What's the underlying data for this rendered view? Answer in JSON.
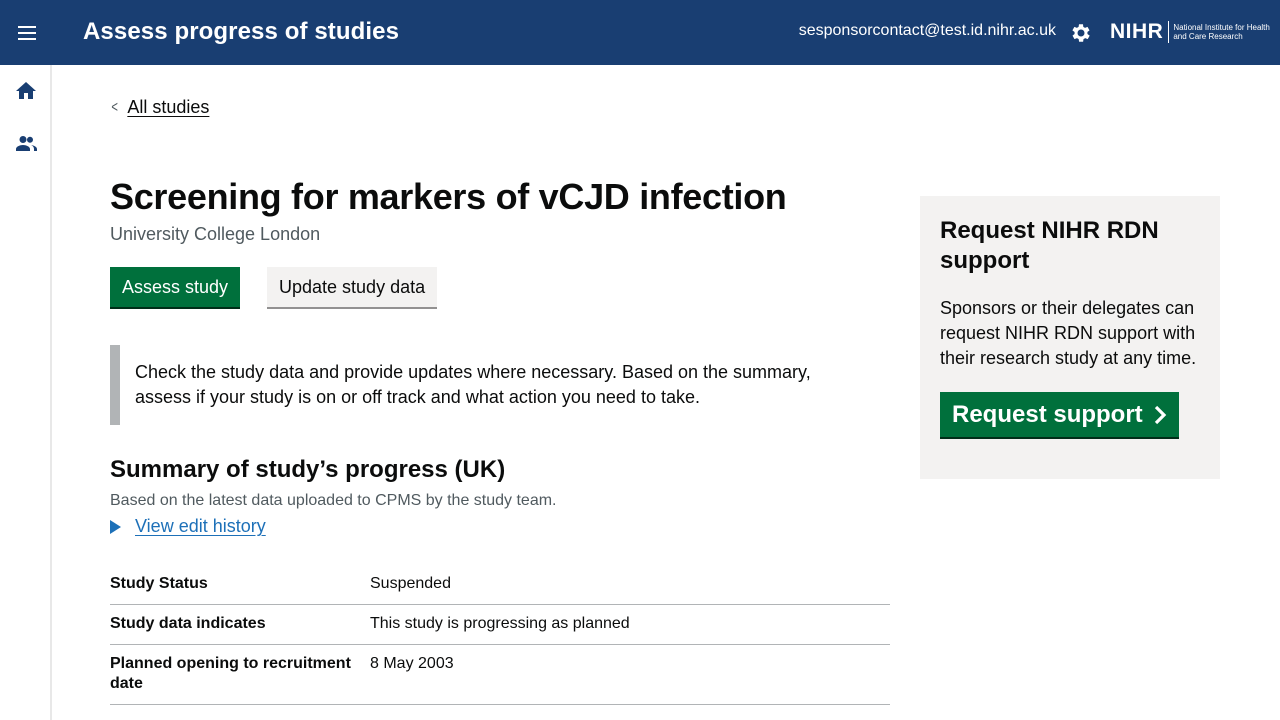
{
  "header": {
    "app_title": "Assess progress of studies",
    "user_email": "sesponsorcontact@test.id.nihr.ac.uk",
    "logo_mark": "NIHR",
    "logo_text": "National Institute for Health and Care Research",
    "menu_icon": "hamburger-menu-icon",
    "settings_icon": "gear-icon",
    "bg_color": "#193e72"
  },
  "sidebar": {
    "items": [
      {
        "icon": "home-icon"
      },
      {
        "icon": "users-icon"
      }
    ]
  },
  "breadcrumb": {
    "back_label": "All studies"
  },
  "study": {
    "title": "Screening for markers of vCJD infection",
    "organisation": "University College London"
  },
  "actions": {
    "assess_label": "Assess study",
    "update_label": "Update study data",
    "primary_color": "#00703c"
  },
  "inset_text": "Check the study data and provide updates where necessary. Based on the summary, assess if your study is on or off track and what action you need to take.",
  "summary": {
    "title": "Summary of study’s progress (UK)",
    "subtitle": "Based on the latest data uploaded to CPMS by the study team.",
    "history_link": "View edit history",
    "rows": [
      {
        "key": "Study Status",
        "value": "Suspended"
      },
      {
        "key": "Study data indicates",
        "value": "This study is progressing as planned"
      },
      {
        "key": "Planned opening to recruitment date",
        "value": "8 May 2003"
      }
    ]
  },
  "support": {
    "title": "Request NIHR RDN support",
    "body": "Sponsors or their delegates can request NIHR RDN support with their research study at any time.",
    "button_label": "Request support"
  }
}
